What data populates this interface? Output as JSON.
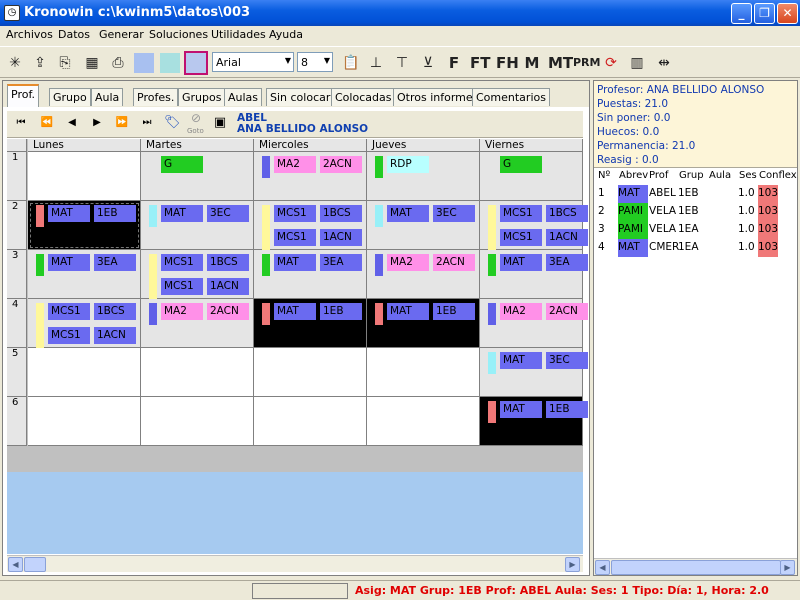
{
  "window": {
    "title": "Kronowin  c:\\kwinm5\\datos\\003"
  },
  "menu": [
    "Archivos",
    "Datos",
    "Generar",
    "Soluciones",
    "Utilidades",
    "Ayuda"
  ],
  "toolbar": {
    "font_label": "Arial",
    "size_value": "8",
    "letter_buttons": [
      "F",
      "FT",
      "FH",
      "M",
      "MT",
      "PRM"
    ]
  },
  "tabs": [
    "Prof.",
    "Grupo",
    "Aula",
    "Profes.",
    "Grupos",
    "Aulas",
    "Sin colocar",
    "Colocadas",
    "Otros informes",
    "Comentarios"
  ],
  "nav": {
    "goto_label": "Goto",
    "abbr": "ABEL",
    "name": "ANA BELLIDO ALONSO"
  },
  "days": [
    "Lunes",
    "Martes",
    "Miercoles",
    "Jueves",
    "Viernes"
  ],
  "hours": [
    "1",
    "2",
    "3",
    "4",
    "5",
    "6"
  ],
  "schedule": [
    [
      {
        "bg": "white",
        "items": []
      },
      {
        "bg": "grey",
        "items": [
          {
            "marker": "",
            "a": "G",
            "b": "",
            "ca": "#22cc22",
            "cb": ""
          }
        ]
      },
      {
        "bg": "grey",
        "items": [
          {
            "marker": "#6060e8",
            "a": "MA2",
            "b": "2ACN",
            "ca": "#ff90e8",
            "cb": "#ff90e8"
          }
        ]
      },
      {
        "bg": "grey",
        "items": [
          {
            "marker": "#22cc22",
            "a": "RDP",
            "b": "",
            "ca": "#b8ffff",
            "cb": ""
          }
        ]
      },
      {
        "bg": "grey",
        "items": [
          {
            "marker": "",
            "a": "G",
            "b": "",
            "ca": "#22cc22",
            "cb": ""
          }
        ]
      }
    ],
    [
      {
        "bg": "black",
        "focus": true,
        "items": [
          {
            "marker": "#f07878",
            "a": "MAT",
            "b": "1EB",
            "ca": "#6a6af0",
            "cb": "#6a6af0"
          }
        ]
      },
      {
        "bg": "grey",
        "items": [
          {
            "marker": "#98f0f8",
            "a": "MAT",
            "b": "3EC",
            "ca": "#6a6af0",
            "cb": "#6a6af0"
          }
        ]
      },
      {
        "bg": "grey",
        "items": [
          {
            "marker": "#fff89a",
            "a": "MCS1",
            "b": "1BCS",
            "ca": "#6a6af0",
            "cb": "#6a6af0"
          },
          {
            "marker": "#fff89a",
            "a": "MCS1",
            "b": "1ACN",
            "ca": "#6a6af0",
            "cb": "#6a6af0"
          }
        ]
      },
      {
        "bg": "grey",
        "items": [
          {
            "marker": "#98f0f8",
            "a": "MAT",
            "b": "3EC",
            "ca": "#6a6af0",
            "cb": "#6a6af0"
          }
        ]
      },
      {
        "bg": "grey",
        "items": [
          {
            "marker": "#fff89a",
            "a": "MCS1",
            "b": "1BCS",
            "ca": "#6a6af0",
            "cb": "#6a6af0"
          },
          {
            "marker": "#fff89a",
            "a": "MCS1",
            "b": "1ACN",
            "ca": "#6a6af0",
            "cb": "#6a6af0"
          }
        ]
      }
    ],
    [
      {
        "bg": "grey",
        "items": [
          {
            "marker": "#22cc22",
            "a": "MAT",
            "b": "3EA",
            "ca": "#6a6af0",
            "cb": "#6a6af0"
          }
        ]
      },
      {
        "bg": "grey",
        "items": [
          {
            "marker": "#fff89a",
            "a": "MCS1",
            "b": "1BCS",
            "ca": "#6a6af0",
            "cb": "#6a6af0"
          },
          {
            "marker": "#fff89a",
            "a": "MCS1",
            "b": "1ACN",
            "ca": "#6a6af0",
            "cb": "#6a6af0"
          }
        ]
      },
      {
        "bg": "grey",
        "items": [
          {
            "marker": "#22cc22",
            "a": "MAT",
            "b": "3EA",
            "ca": "#6a6af0",
            "cb": "#6a6af0"
          }
        ]
      },
      {
        "bg": "grey",
        "items": [
          {
            "marker": "#6060e8",
            "a": "MA2",
            "b": "2ACN",
            "ca": "#ff90e8",
            "cb": "#ff90e8"
          }
        ]
      },
      {
        "bg": "grey",
        "items": [
          {
            "marker": "#22cc22",
            "a": "MAT",
            "b": "3EA",
            "ca": "#6a6af0",
            "cb": "#6a6af0"
          }
        ]
      }
    ],
    [
      {
        "bg": "grey",
        "items": [
          {
            "marker": "#fff89a",
            "a": "MCS1",
            "b": "1BCS",
            "ca": "#6a6af0",
            "cb": "#6a6af0"
          },
          {
            "marker": "#fff89a",
            "a": "MCS1",
            "b": "1ACN",
            "ca": "#6a6af0",
            "cb": "#6a6af0"
          }
        ]
      },
      {
        "bg": "grey",
        "items": [
          {
            "marker": "#6060e8",
            "a": "MA2",
            "b": "2ACN",
            "ca": "#ff90e8",
            "cb": "#ff90e8"
          }
        ]
      },
      {
        "bg": "black",
        "items": [
          {
            "marker": "#f07878",
            "a": "MAT",
            "b": "1EB",
            "ca": "#6a6af0",
            "cb": "#6a6af0"
          }
        ]
      },
      {
        "bg": "black",
        "items": [
          {
            "marker": "#f07878",
            "a": "MAT",
            "b": "1EB",
            "ca": "#6a6af0",
            "cb": "#6a6af0"
          }
        ]
      },
      {
        "bg": "grey",
        "items": [
          {
            "marker": "#6060e8",
            "a": "MA2",
            "b": "2ACN",
            "ca": "#ff90e8",
            "cb": "#ff90e8"
          }
        ]
      }
    ],
    [
      {
        "bg": "white",
        "items": []
      },
      {
        "bg": "white",
        "items": []
      },
      {
        "bg": "white",
        "items": []
      },
      {
        "bg": "white",
        "items": []
      },
      {
        "bg": "grey",
        "items": [
          {
            "marker": "#98f0f8",
            "a": "MAT",
            "b": "3EC",
            "ca": "#6a6af0",
            "cb": "#6a6af0"
          }
        ]
      }
    ],
    [
      {
        "bg": "white",
        "items": []
      },
      {
        "bg": "white",
        "items": []
      },
      {
        "bg": "white",
        "items": []
      },
      {
        "bg": "white",
        "items": []
      },
      {
        "bg": "black",
        "items": [
          {
            "marker": "#f07878",
            "a": "MAT",
            "b": "1EB",
            "ca": "#6a6af0",
            "cb": "#6a6af0"
          }
        ]
      }
    ]
  ],
  "info": [
    "Profesor: ANA BELLIDO ALONSO",
    "Puestas: 21.0",
    "Sin poner: 0.0",
    "Huecos: 0.0",
    "Permanencia: 21.0",
    "Reasig : 0.0"
  ],
  "conflict_headers": [
    "Nº",
    "Abrev",
    "Prof",
    "Grup",
    "Aula",
    "Ses",
    "Conflex"
  ],
  "conflicts": [
    {
      "n": "1",
      "abrev": "MAT",
      "prof": "ABEL",
      "grup": "1EB",
      "aula": "",
      "ses": "1.0",
      "conf": "103",
      "abrev_color": "#6a6af0"
    },
    {
      "n": "2",
      "abrev": "PAMI",
      "prof": "VELA",
      "grup": "1EB",
      "aula": "",
      "ses": "1.0",
      "conf": "103",
      "abrev_color": "#22cc22"
    },
    {
      "n": "3",
      "abrev": "PAMI",
      "prof": "VELA",
      "grup": "1EA",
      "aula": "",
      "ses": "1.0",
      "conf": "103",
      "abrev_color": "#22cc22"
    },
    {
      "n": "4",
      "abrev": "MAT",
      "prof": "CMER",
      "grup": "1EA",
      "aula": "",
      "ses": "1.0",
      "conf": "103",
      "abrev_color": "#6a6af0"
    }
  ],
  "status": "Asig: MAT  Grup: 1EB  Prof: ABEL  Aula:     Ses: 1  Tipo:  Día: 1, Hora: 2.0"
}
